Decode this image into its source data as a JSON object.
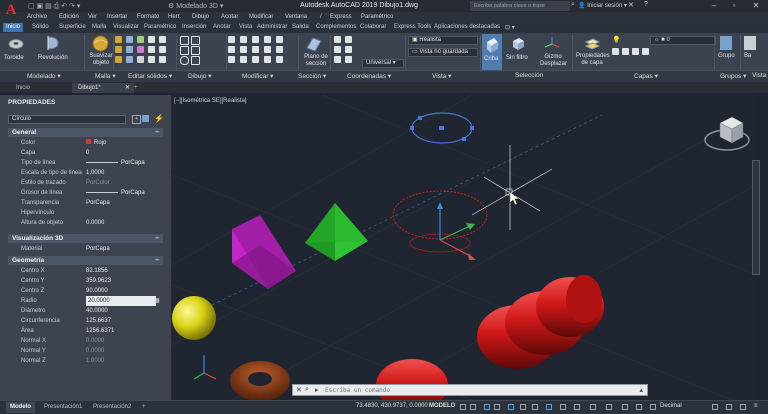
{
  "app": {
    "logo_letter": "A",
    "workspace": "Modelado 3D",
    "title": "Autodesk AutoCAD 2019    Dibujo1.dwg",
    "search_placeholder": "Escriba palabra clave o frase",
    "signin": "Iniciar sesión"
  },
  "menu": [
    "Archivo",
    "Edición",
    "Ver",
    "Insertar",
    "Formato",
    "Herr.",
    "Dibujo",
    "Acotar",
    "Modificar",
    "Ventana",
    "/",
    "Express",
    "Paramétrico"
  ],
  "ribbon_tabs": [
    "Inicio",
    "Sólido",
    "Superficie",
    "Malla",
    "Visualizar",
    "Paramétrico",
    "Inserción",
    "Anotar",
    "Vista",
    "Administrar",
    "Salida",
    "Complementos",
    "Colaborar",
    "Express Tools",
    "Aplicaciones destacadas"
  ],
  "ribbon": {
    "big_buttons": {
      "toroide": "Toroide",
      "revolucion": "Revolución",
      "suavizar": "Suavizar objeto",
      "plano_seccion": "Plano de sección",
      "criba": "Criba",
      "sin_filtro": "Sin filtro",
      "gizmo": "Gizmo Desplazar",
      "propiedades_capa": "Propiedades de capa",
      "grupo": "Grupo",
      "base": "Ba"
    },
    "dropdowns": {
      "visual_style": "Realista",
      "view": "Vista no guardada",
      "ucs": "Universal",
      "layer": "0"
    },
    "panels": [
      "Modelado",
      "Malla",
      "Editar sólidos",
      "Dibujo",
      "Modificar",
      "Sección",
      "Coordenadas",
      "Vista",
      "Selección",
      "Capas",
      "Grupos",
      "Vista"
    ]
  },
  "doc_tabs": [
    "Inicio",
    "Dibujo1*"
  ],
  "properties": {
    "title": "PROPIEDADES",
    "object_type": "Círculo",
    "sections": [
      {
        "name": "General",
        "toggle": "−",
        "rows": [
          {
            "k": "Color",
            "v": "Rojo"
          },
          {
            "k": "Capa",
            "v": "0"
          },
          {
            "k": "Tipo de línea",
            "v": "PorCapa"
          },
          {
            "k": "Escala de tipo de línea",
            "v": "1.0000"
          },
          {
            "k": "Estilo de trazado",
            "v": "PorColor"
          },
          {
            "k": "Grosor de línea",
            "v": "PorCapa"
          },
          {
            "k": "Transparencia",
            "v": "PorCapa"
          },
          {
            "k": "Hipervínculo",
            "v": ""
          },
          {
            "k": "Altura de objeto",
            "v": "0.0000"
          }
        ]
      },
      {
        "name": "Visualización 3D",
        "toggle": "−",
        "rows": [
          {
            "k": "Material",
            "v": "PorCapa"
          }
        ]
      },
      {
        "name": "Geometría",
        "toggle": "−",
        "rows": [
          {
            "k": "Centro X",
            "v": "82.1856"
          },
          {
            "k": "Centro Y",
            "v": "359.9623"
          },
          {
            "k": "Centro Z",
            "v": "90.0000"
          },
          {
            "k": "Radio",
            "v": "20.0000"
          },
          {
            "k": "Diámetro",
            "v": "40.0000"
          },
          {
            "k": "Circunferencia",
            "v": "125.6637"
          },
          {
            "k": "Área",
            "v": "1256.6371"
          },
          {
            "k": "Normal X",
            "v": "0.0000"
          },
          {
            "k": "Normal Y",
            "v": "0.0000"
          },
          {
            "k": "Normal Z",
            "v": "1.0000"
          }
        ]
      }
    ]
  },
  "viewport": {
    "label": "[−][Isométrica SE][Realista]",
    "viewcube_face": "SUPERIOR"
  },
  "command": {
    "placeholder": "Escriba un comando"
  },
  "status": {
    "layout_tabs": [
      "Modelo",
      "Presentación1",
      "Presentación2"
    ],
    "add_tab": "+",
    "coords": "73.4830, 430.9737, 0.0000",
    "mode": "MODELO",
    "units": "Decimal"
  },
  "colors": {
    "accent": "#3b76b0",
    "selection_circle": "#e0312e",
    "pyramid": "#27b02a",
    "wedge": "#c425c8",
    "sphere": "#d8d414",
    "torus": "#8b3a12",
    "cylinder": "#d01818"
  }
}
